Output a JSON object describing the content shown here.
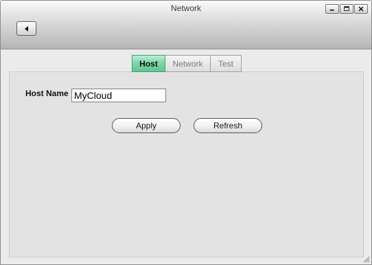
{
  "window": {
    "title": "Network",
    "controls": [
      "minimize-icon",
      "maximize-icon",
      "close-icon"
    ]
  },
  "toolbar": {
    "back_icon": "triangle-left-icon"
  },
  "tabs": [
    {
      "label": "Host",
      "active": true
    },
    {
      "label": "Network",
      "active": false
    },
    {
      "label": "Test",
      "active": false
    }
  ],
  "host_form": {
    "host_name_label": "Host Name",
    "host_name_value": "MyCloud"
  },
  "buttons": {
    "apply_label": "Apply",
    "refresh_label": "Refresh"
  },
  "colors": {
    "active_tab": "#7fd6aa",
    "titlebar": "#c6c6c6",
    "panel": "#e3e3e3"
  }
}
